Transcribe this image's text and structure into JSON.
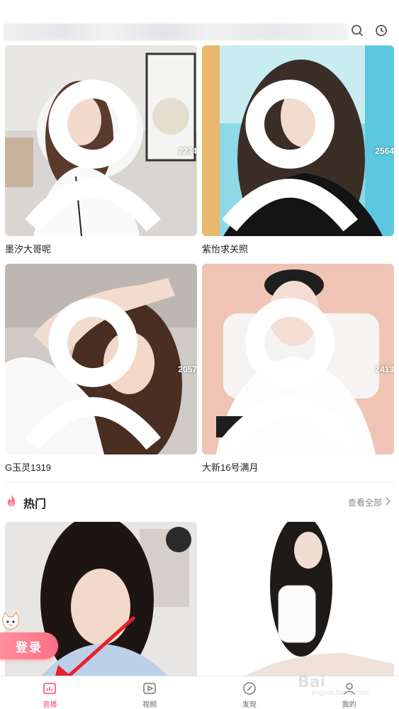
{
  "header": {
    "search_icon": "search-icon",
    "history_icon": "history-icon"
  },
  "streams": [
    {
      "name": "墨汐大哥呢",
      "viewers": "2234"
    },
    {
      "name": "紫怡求关照",
      "viewers": "2564"
    },
    {
      "name": "G玉灵1319",
      "viewers": "2057"
    },
    {
      "name": "大新16号满月",
      "viewers": "2413"
    }
  ],
  "hot_section": {
    "title": "热门",
    "see_all": "查看全部"
  },
  "login": {
    "label": "登录"
  },
  "nav": [
    {
      "label": "直播",
      "icon": "live-icon",
      "active": true
    },
    {
      "label": "视频",
      "icon": "video-icon",
      "active": false
    },
    {
      "label": "发现",
      "icon": "discover-icon",
      "active": false
    },
    {
      "label": "我的",
      "icon": "profile-icon",
      "active": false
    }
  ],
  "watermark": {
    "brand": "Bai",
    "sub": "jingyan.baidu.com"
  },
  "colors": {
    "accent": "#ff4d73",
    "login_gradient_start": "#ff8f9e",
    "login_gradient_end": "#ff6f86",
    "annotation_arrow": "#e8202a"
  }
}
